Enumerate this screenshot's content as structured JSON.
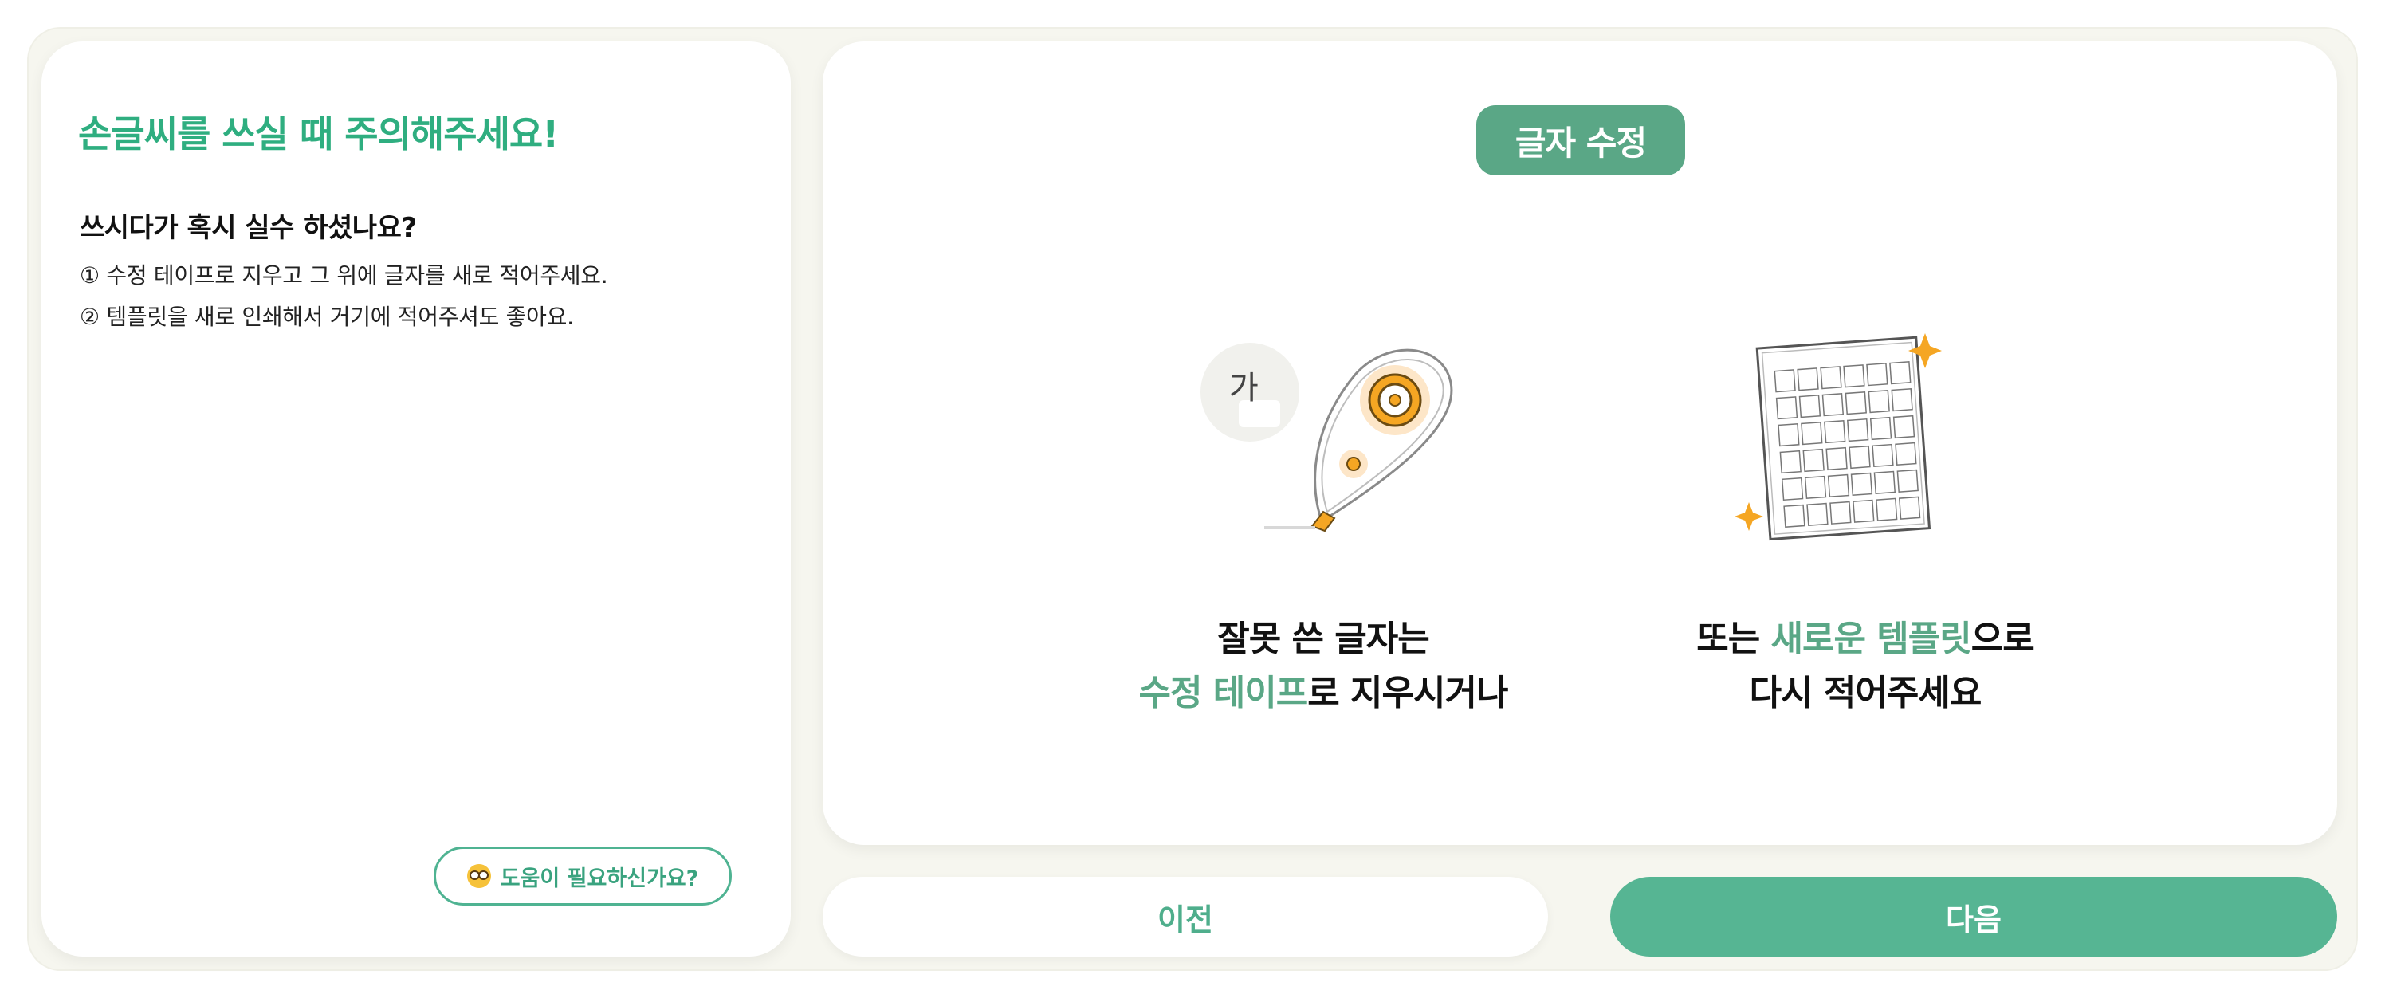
{
  "notice": {
    "title": "손글씨를 쓰실 때 주의해주세요!",
    "subtitle": "쓰시다가 혹시 실수 하셨나요?",
    "lines": [
      "① 수정 테이프로 지우고 그 위에 글자를 새로 적어주세요.",
      "② 템플릿을 새로 인쇄해서 거기에 적어주셔도 좋아요."
    ]
  },
  "help": {
    "icon": "nerd-face-icon",
    "label": "도움이 필요하신가요?"
  },
  "section": {
    "tag": "글자 수정"
  },
  "options": [
    {
      "icon": "correction-tape-icon",
      "sample_text": "가",
      "caption_line1": "잘못 쓴 글자는",
      "caption_highlight": "수정 테이프",
      "caption_line2_rest": "로 지우시거나"
    },
    {
      "icon": "new-template-sheet-icon",
      "caption_line1_pre": "또는 ",
      "caption_highlight": "새로운 템플릿",
      "caption_line1_post": "으로",
      "caption_line2": "다시 적어주세요"
    }
  ],
  "nav": {
    "prev_label": "이전",
    "next_label": "다음"
  },
  "colors": {
    "accent": "#5aa786",
    "title_green": "#2fae80",
    "background": "#f6f6ef",
    "sparkle": "#f5a623"
  }
}
